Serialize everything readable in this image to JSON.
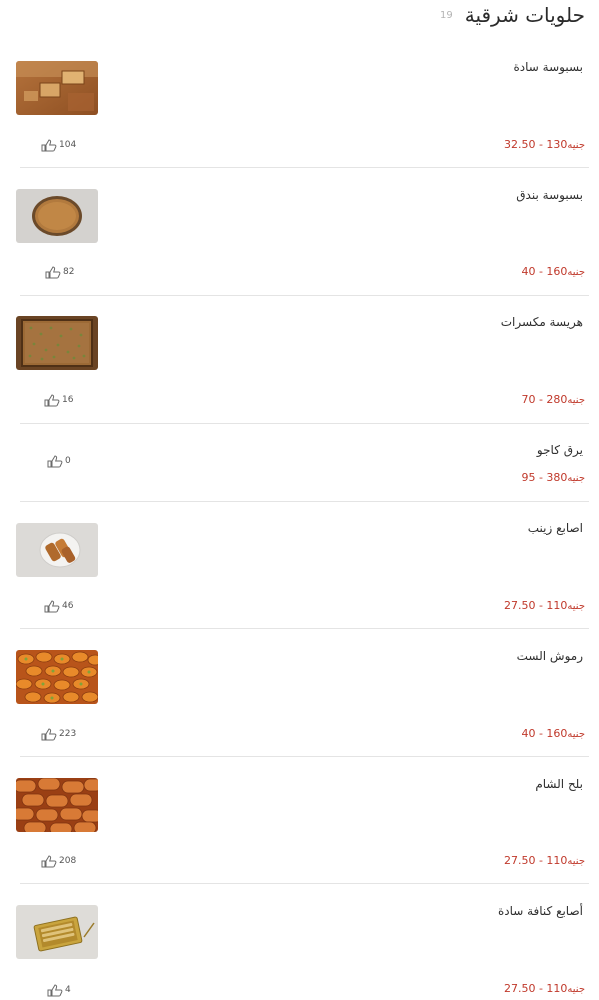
{
  "header": {
    "title": "حلويات شرقية",
    "count": "19"
  },
  "currency": "جنيه",
  "colors": {
    "price": "#c0392b",
    "divider": "#e4e4e4"
  },
  "items": [
    {
      "name": "بسبوسة سادة",
      "price": "32.50 - 130",
      "likes": "104",
      "image": "basbousa-plain-photo"
    },
    {
      "name": "بسبوسة بندق",
      "price": "40 - 160",
      "likes": "82",
      "image": "basbousa-hazelnut-photo"
    },
    {
      "name": "هريسة مكسرات",
      "price": "70 - 280",
      "likes": "16",
      "image": "harissa-nuts-photo"
    },
    {
      "name": "يرق كاجو",
      "price": "95 - 380",
      "likes": "0",
      "image": ""
    },
    {
      "name": "اصابع زينب",
      "price": "27.50 - 110",
      "likes": "46",
      "image": "zainab-fingers-photo"
    },
    {
      "name": "رموش الست",
      "price": "40 - 160",
      "likes": "223",
      "image": "remoush-el-set-photo"
    },
    {
      "name": "بلح الشام",
      "price": "27.50 - 110",
      "likes": "208",
      "image": "balah-el-sham-photo"
    },
    {
      "name": "أصابع كنافة سادة",
      "price": "27.50 - 110",
      "likes": "4",
      "image": "kunafa-fingers-photo"
    }
  ]
}
